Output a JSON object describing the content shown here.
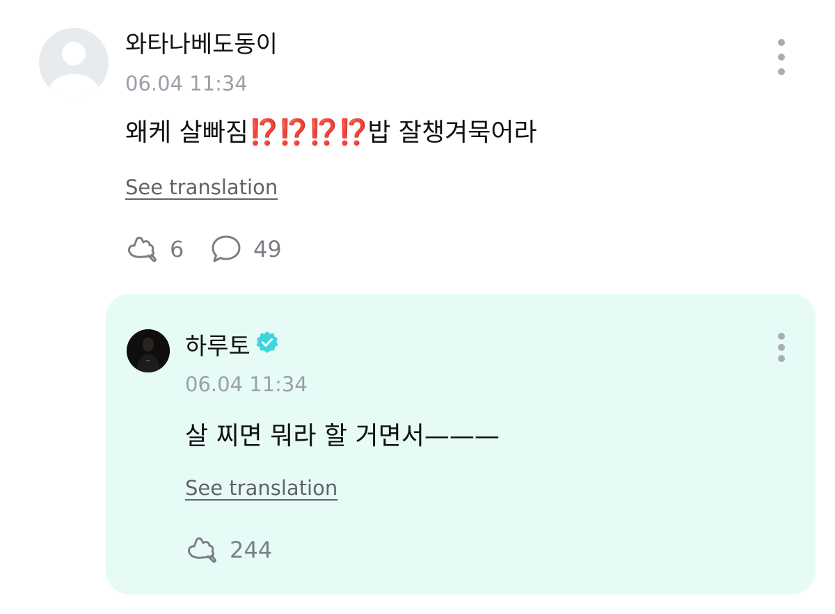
{
  "comment": {
    "author": "와타나베도동이",
    "timestamp": "06.04 11:34",
    "text_before": "왜케 살빠짐",
    "emojis": "⁉️⁉️⁉️⁉️",
    "text_after": "밥 잘챙겨묵어라",
    "see_translation": "See translation",
    "like_count": "6",
    "reply_count": "49",
    "avatar_icon": "default-user-avatar",
    "more_icon": "vertical-ellipsis-icon"
  },
  "reply": {
    "author": "하루토",
    "verified_icon": "verified-badge-icon",
    "timestamp": "06.04 11:34",
    "text": "살 찌면 뭐라 할 거면서———",
    "see_translation": "See translation",
    "like_count": "244",
    "more_icon": "vertical-ellipsis-icon"
  },
  "colors": {
    "reply_background": "#e6fbf6",
    "verified_badge": "#3dd6dc",
    "emoji_red": "#e23b2e",
    "muted_text": "#9aa0a6"
  }
}
